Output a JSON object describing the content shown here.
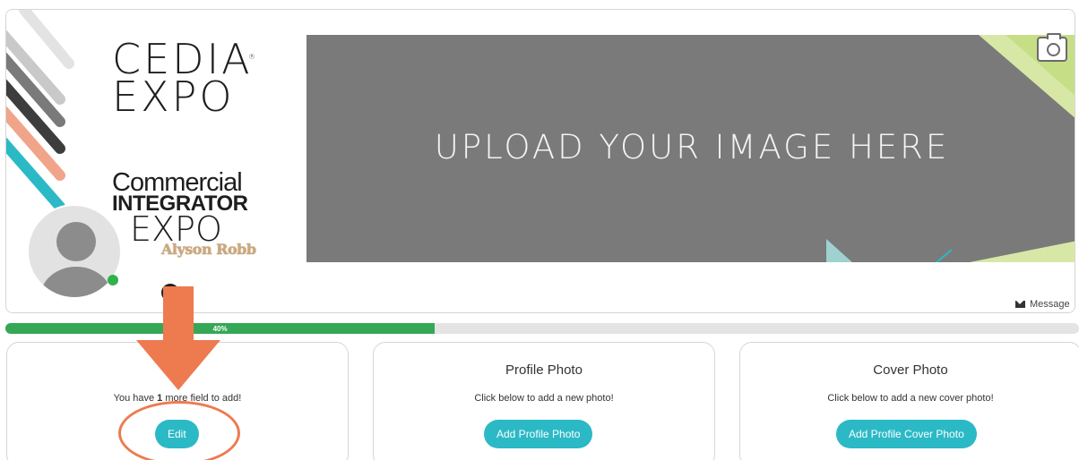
{
  "cover": {
    "logo_cedia": "CEDIA",
    "logo_cedia_reg": "®",
    "logo_expo": "EXPO",
    "logo_ci_line1": "Commercial",
    "logo_ci_line2": "INTEGRATOR",
    "logo_ci_line3": "EXPO",
    "upload_text": "UPLOAD YOUR IMAGE HERE",
    "camera_icon": "camera-icon"
  },
  "profile": {
    "name": "Alyson Robb",
    "online": true,
    "message_label": "Message"
  },
  "progress": {
    "percent": 40,
    "label": "40%"
  },
  "cards": [
    {
      "title": "",
      "desc_prefix": "You have ",
      "desc_count": "1",
      "desc_suffix": " more field to add!",
      "button": "Edit"
    },
    {
      "title": "Profile Photo",
      "desc": "Click below to add a new photo!",
      "button": "Add Profile Photo"
    },
    {
      "title": "Cover Photo",
      "desc": "Click below to add a new cover photo!",
      "button": "Add Profile Cover Photo"
    }
  ],
  "colors": {
    "accent": "#2bb9c6",
    "progress": "#35a855",
    "annotation": "#ee7a50",
    "upload_bg": "#7a7a7a"
  }
}
